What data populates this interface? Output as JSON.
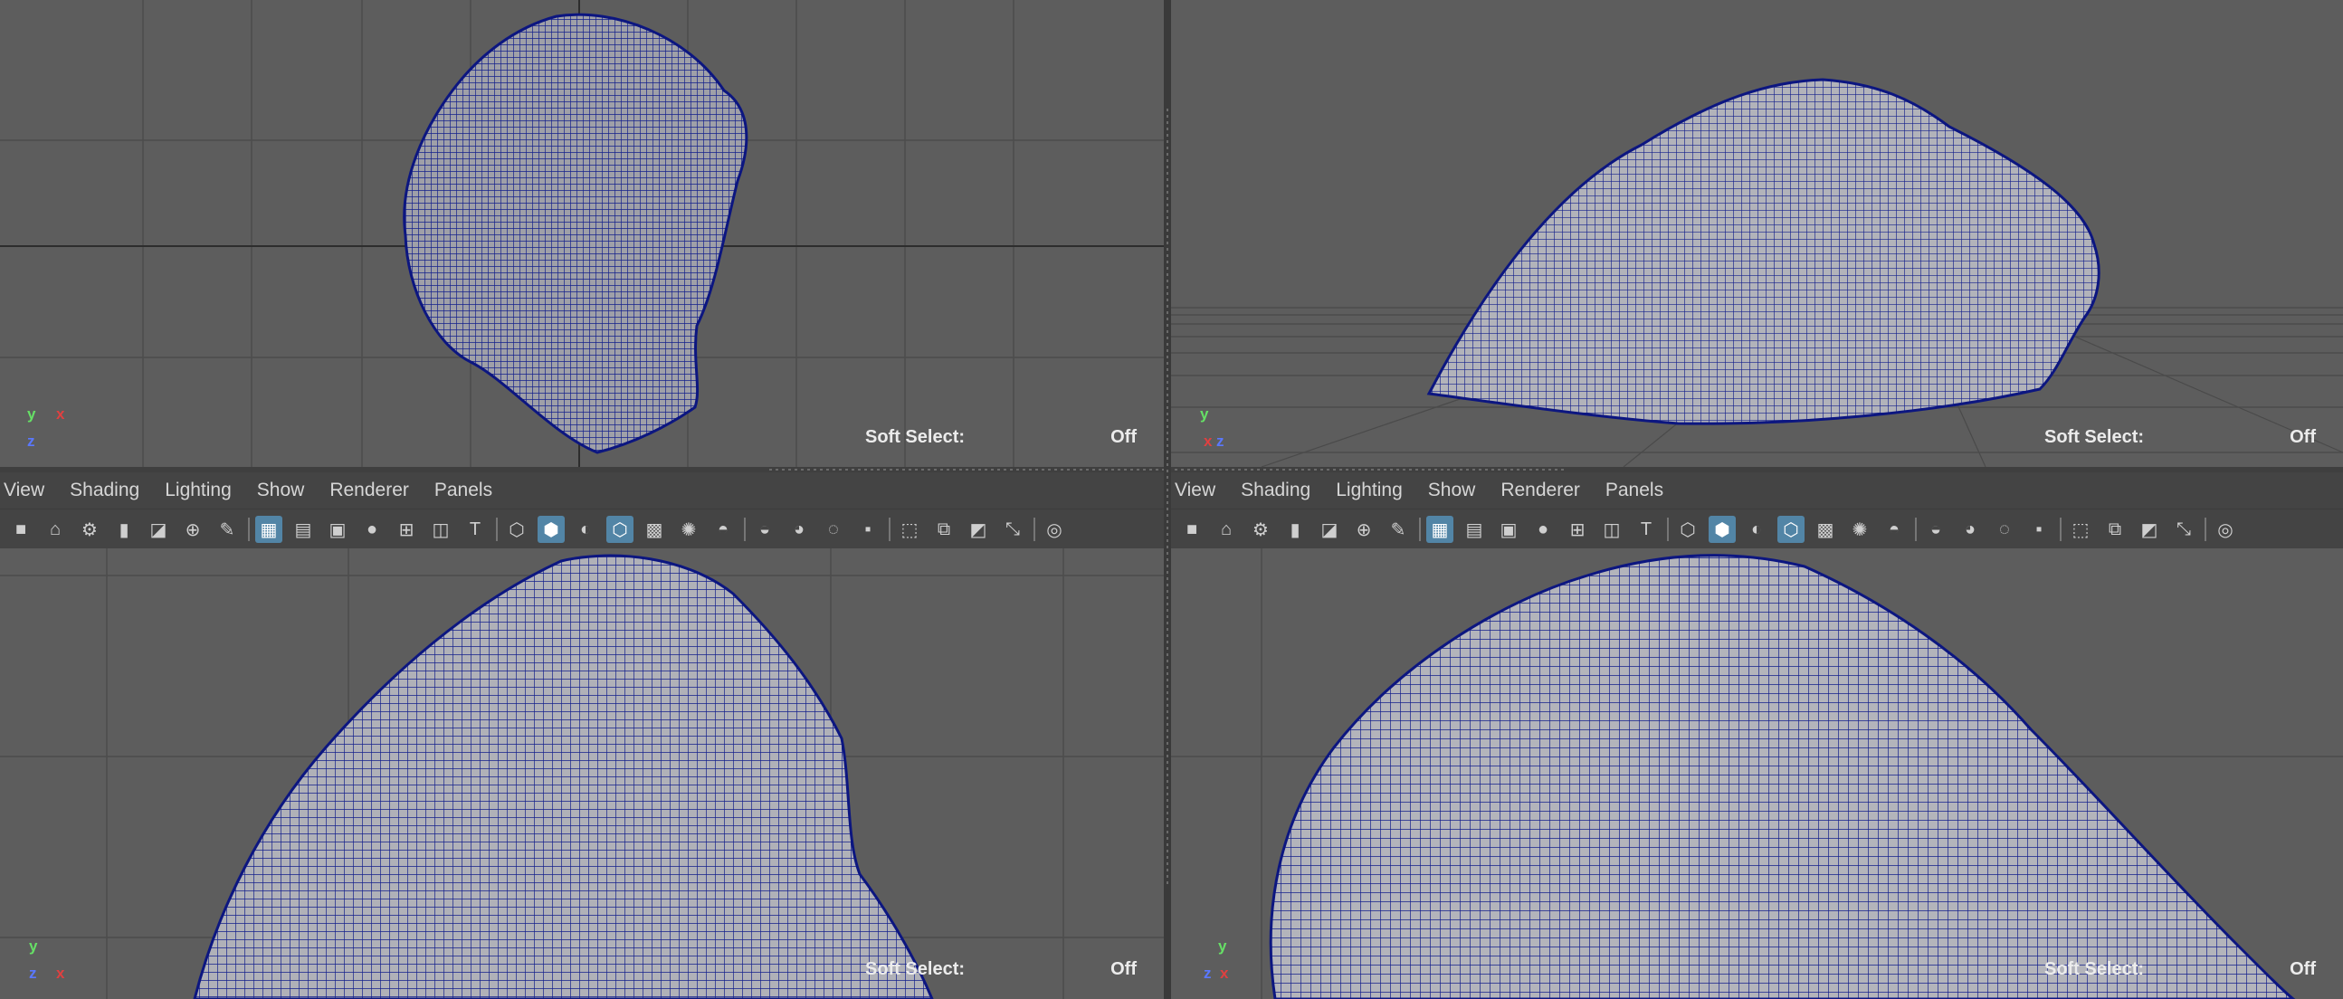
{
  "panels": [
    {
      "menu": [
        "View",
        "Shading",
        "Lighting",
        "Show",
        "Renderer",
        "Panels"
      ]
    },
    {
      "menu": [
        "View",
        "Shading",
        "Lighting",
        "Show",
        "Renderer",
        "Panels"
      ]
    }
  ],
  "viewports": {
    "top_left": {
      "soft_select_label": "Soft Select:",
      "soft_select_value": "Off",
      "axes": {
        "y": "y",
        "x": "x",
        "z": "z"
      }
    },
    "top_right": {
      "soft_select_label": "Soft Select:",
      "soft_select_value": "Off",
      "axes": {
        "y": "y",
        "x": "x",
        "z": "z"
      }
    },
    "bottom_left": {
      "soft_select_label": "Soft Select:",
      "soft_select_value": "Off",
      "axes": {
        "y": "y",
        "x": "x",
        "z": "z"
      }
    },
    "bottom_right": {
      "soft_select_label": "Soft Select:",
      "soft_select_value": "Off",
      "axes": {
        "y": "y",
        "x": "x",
        "z": "z"
      }
    }
  },
  "toolbar_icons": [
    "camera-icon",
    "lock-camera-icon",
    "camera-attributes-icon",
    "bookmark-icon",
    "image-plane-icon",
    "two-d-pan-zoom-icon",
    "grease-pencil-icon",
    "separator",
    "grid-icon",
    "film-gate-icon",
    "resolution-gate-icon",
    "gate-mask-icon",
    "field-chart-icon",
    "safe-action-icon",
    "safe-title-icon",
    "separator",
    "wireframe-icon",
    "smooth-shade-icon",
    "use-default-material-icon",
    "wireframe-on-shaded-icon",
    "textured-icon",
    "use-all-lights-icon",
    "shadows-icon",
    "separator",
    "screen-space-ao-icon",
    "motion-blur-icon",
    "anti-aliasing-icon",
    "depth-of-field-icon",
    "separator",
    "isolate-select-icon",
    "xray-icon",
    "xray-active-components-icon",
    "xray-joints-icon",
    "backface-culling-icon",
    "separator",
    "exposure-icon"
  ],
  "colors": {
    "viewport_bg": "#5d5d5d",
    "panel_bg": "#444444",
    "wire": "#101a8c",
    "mesh_fill": "#a8a8ae",
    "active_icon_bg": "#5285a6"
  }
}
